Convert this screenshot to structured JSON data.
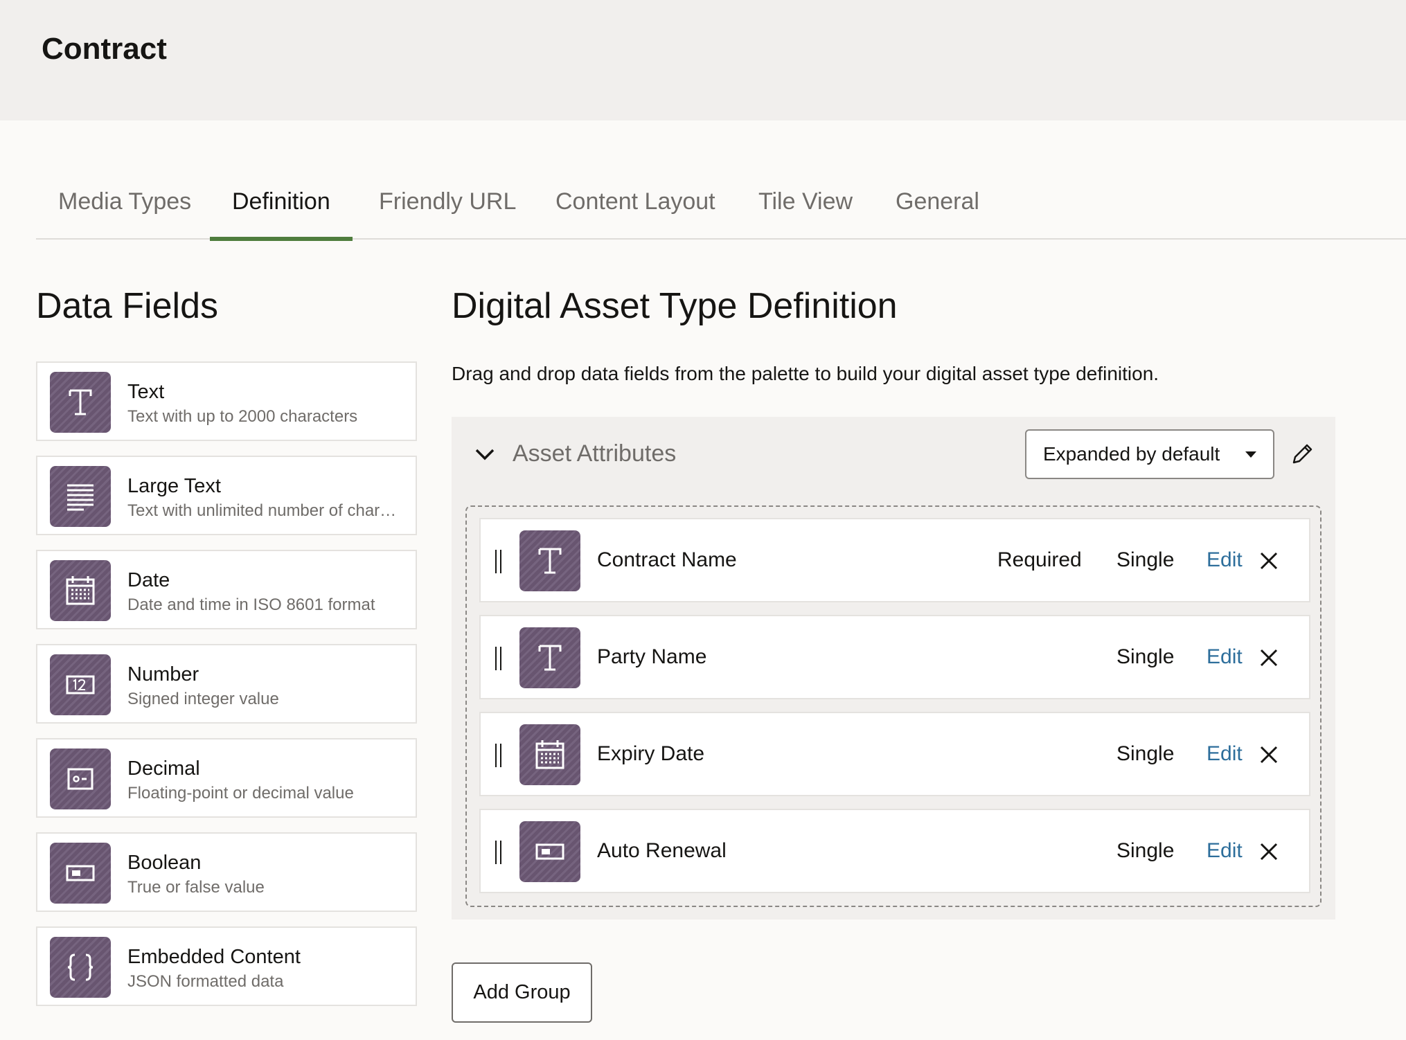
{
  "header": {
    "title": "Contract"
  },
  "tabs": [
    {
      "label": "Media Types"
    },
    {
      "label": "Definition"
    },
    {
      "label": "Friendly URL"
    },
    {
      "label": "Content Layout"
    },
    {
      "label": "Tile View"
    },
    {
      "label": "General"
    }
  ],
  "active_tab": "Definition",
  "palette": {
    "heading": "Data Fields",
    "items": [
      {
        "name": "Text",
        "description": "Text with up to 2000 characters",
        "icon": "text-icon"
      },
      {
        "name": "Large Text",
        "description": "Text with unlimited number of characters",
        "icon": "large-text-icon"
      },
      {
        "name": "Date",
        "description": "Date and time in ISO 8601 format",
        "icon": "calendar-icon"
      },
      {
        "name": "Number",
        "description": "Signed integer value",
        "icon": "number-icon"
      },
      {
        "name": "Decimal",
        "description": "Floating-point or decimal value",
        "icon": "decimal-icon"
      },
      {
        "name": "Boolean",
        "description": "True or false value",
        "icon": "boolean-icon"
      },
      {
        "name": "Embedded Content",
        "description": "JSON formatted data",
        "icon": "braces-icon"
      }
    ]
  },
  "definition": {
    "heading": "Digital Asset Type Definition",
    "instructions": "Drag and drop data fields from the palette to build your digital asset type definition.",
    "group": {
      "title": "Asset Attributes",
      "display_mode": "Expanded by default",
      "fields": [
        {
          "name": "Contract Name",
          "required": "Required",
          "cardinality": "Single",
          "edit_label": "Edit",
          "icon": "text-icon"
        },
        {
          "name": "Party Name",
          "required": "",
          "cardinality": "Single",
          "edit_label": "Edit",
          "icon": "text-icon"
        },
        {
          "name": "Expiry Date",
          "required": "",
          "cardinality": "Single",
          "edit_label": "Edit",
          "icon": "calendar-icon"
        },
        {
          "name": "Auto Renewal",
          "required": "",
          "cardinality": "Single",
          "edit_label": "Edit",
          "icon": "boolean-icon"
        }
      ]
    },
    "add_group_label": "Add Group"
  },
  "colors": {
    "field_icon_bg": "#6c5875",
    "active_tab_underline": "#4f7d3e",
    "link": "#2d6e9b"
  }
}
